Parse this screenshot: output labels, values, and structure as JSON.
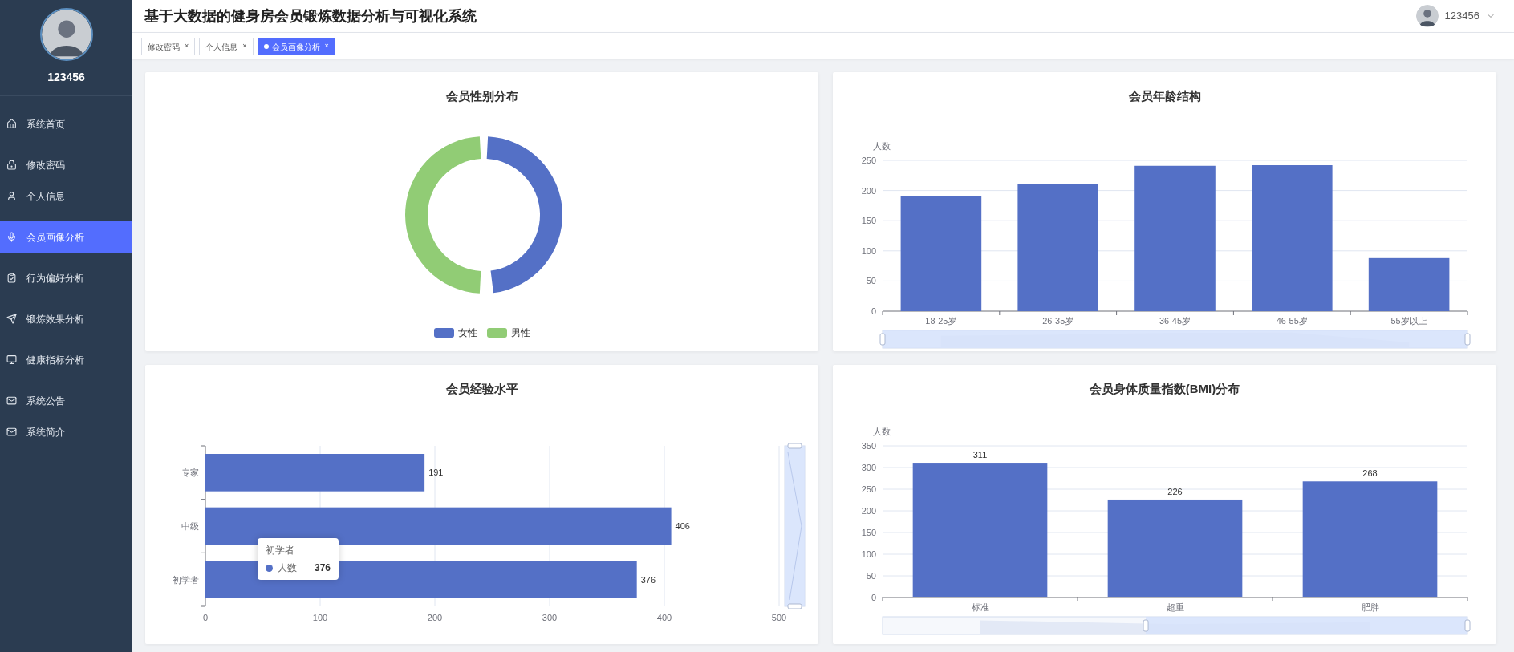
{
  "header": {
    "title": "基于大数据的健身房会员锻炼数据分析与可视化系统",
    "user": {
      "name": "123456"
    }
  },
  "sidebar": {
    "user": {
      "name": "123456"
    },
    "groups": [
      {
        "items": [
          {
            "label": "系统首页",
            "selected": false
          }
        ]
      },
      {
        "items": [
          {
            "label": "修改密码",
            "selected": false
          },
          {
            "label": "个人信息",
            "selected": false
          }
        ]
      },
      {
        "items": [
          {
            "label": "会员画像分析",
            "selected": true
          }
        ]
      },
      {
        "items": [
          {
            "label": "行为偏好分析",
            "selected": false
          }
        ]
      },
      {
        "items": [
          {
            "label": "锻炼效果分析",
            "selected": false
          }
        ]
      },
      {
        "items": [
          {
            "label": "健康指标分析",
            "selected": false
          }
        ]
      },
      {
        "items": [
          {
            "label": "系统公告",
            "selected": false
          },
          {
            "label": "系统简介",
            "selected": false
          }
        ]
      }
    ]
  },
  "tabs": [
    {
      "label": "修改密码",
      "close": "×",
      "selected": false
    },
    {
      "label": "个人信息",
      "close": "×",
      "selected": false
    },
    {
      "label": "会员画像分析",
      "close": "×",
      "selected": true
    }
  ],
  "cards": [
    {
      "kind": "donut",
      "title": "会员性别分布",
      "legend": [
        {
          "label": "女性",
          "color": "#5470c6"
        },
        {
          "label": "男性",
          "color": "#91cc75"
        }
      ]
    },
    {
      "kind": "chart",
      "chart_data": {
        "type": "bar",
        "title": "会员年龄结构",
        "ylabel": "人数",
        "categories": [
          "18-25岁",
          "26-35岁",
          "36-45岁",
          "46-55岁",
          "55岁以上"
        ],
        "series": [
          {
            "color": "#5470c6",
            "values": [
              191,
              211,
              241,
              242,
              88
            ]
          }
        ],
        "ylim": [
          0,
          250
        ],
        "yticks": [
          0,
          50,
          100,
          150,
          200,
          250
        ],
        "grid": true
      },
      "zoom_slider": {
        "level": 1
      }
    },
    {
      "kind": "chart",
      "chart_data": {
        "type": "bar",
        "title": "会员经验水平",
        "orientation": "horizontal",
        "categories": [
          "专家",
          "中级",
          "初学者"
        ],
        "series": [
          {
            "name": "人数",
            "color": "#5470c6",
            "values": [
              191,
              406,
              376
            ]
          }
        ],
        "xlim": [
          0,
          500
        ],
        "xticks": [
          0,
          100,
          200,
          300,
          400,
          500
        ],
        "data_labels": true,
        "grid": true
      },
      "tooltip": {
        "title": "初学者",
        "value": "376",
        "color": "#5470c6"
      },
      "zoom_slider": {
        "level": 1
      }
    },
    {
      "kind": "chart",
      "chart_data": {
        "type": "bar",
        "title": "会员身体质量指数(BMI)分布",
        "ylabel": "人数",
        "categories": [
          "标准",
          "超重",
          "肥胖"
        ],
        "series": [
          {
            "color": "#5470c6",
            "values": [
              311,
              226,
              268
            ]
          }
        ],
        "ylim": [
          0,
          350
        ],
        "yticks": [
          0,
          50,
          100,
          150,
          200,
          250,
          300,
          350
        ],
        "data_labels": true,
        "grid": true
      },
      "zoom_slider": {
        "level": 0.55
      }
    }
  ]
}
